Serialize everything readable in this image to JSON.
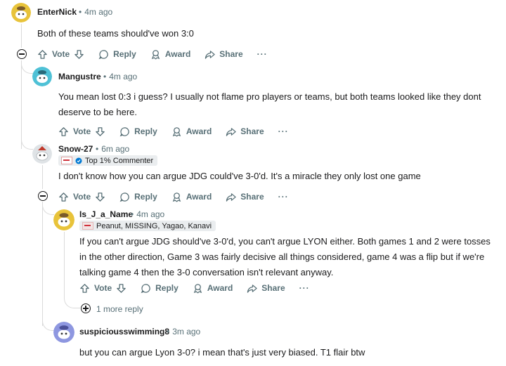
{
  "comments": [
    {
      "author": "EnterNick",
      "time": "4m ago",
      "body": "Both of these teams should've won 3:0"
    },
    {
      "author": "Mangustre",
      "time": "4m ago",
      "body": "You mean lost 0:3 i guess? I usually not flame pro players or teams, but both teams looked like they dont deserve to be here."
    },
    {
      "author": "Snow-27",
      "time": "6m ago",
      "flair": "Top 1% Commenter",
      "body": "I don't know how you can argue JDG could've 3-0'd. It's a miracle they only lost one game"
    },
    {
      "author": "Is_J_a_Name",
      "time": "4m ago",
      "flair": "Peanut, MISSING, Yagao, Kanavi",
      "body": "If you can't argue JDG should've 3-0'd, you can't argue LYON either. Both games 1 and 2 were tosses in the other direction, Game 3 was fairly decisive all things considered, game 4 was a flip but if we're talking game 4 then the 3-0 conversation isn't relevant anyway."
    },
    {
      "author": "suspiciousswimming8",
      "time": "3m ago",
      "body": "but you can argue Lyon 3-0? i mean that's just very biased. T1 flair btw"
    }
  ],
  "actions": {
    "vote": "Vote",
    "reply": "Reply",
    "award": "Award",
    "share": "Share",
    "more": "···"
  },
  "more_replies": "1 more reply",
  "separator": "•",
  "colors": {
    "meta": "#576f76",
    "thread_line": "#dadada",
    "flair_bg": "#eaedef",
    "avatar_yellow": "#e8c33a",
    "avatar_teal": "#4fc1d6",
    "avatar_purple": "#8e97e0"
  }
}
